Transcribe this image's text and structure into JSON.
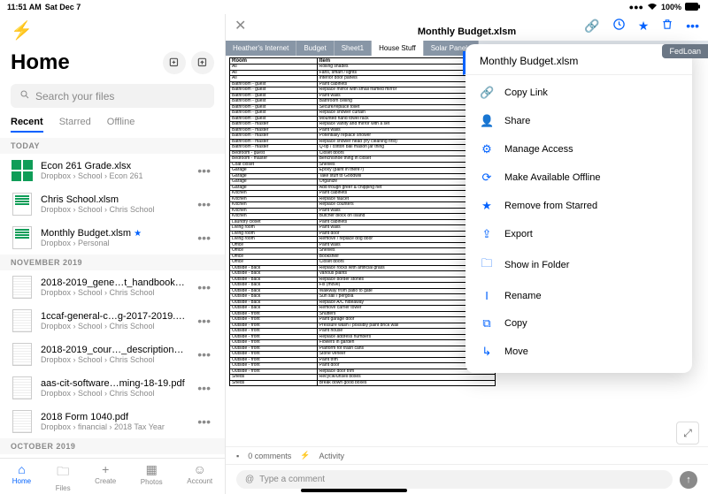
{
  "status": {
    "time": "11:51 AM",
    "date": "Sat Dec 7",
    "signal": "•••",
    "wifi": "⌃",
    "battery_pct": "100%"
  },
  "sidebar": {
    "title": "Home",
    "search_placeholder": "Search your files",
    "tabs": [
      "Recent",
      "Starred",
      "Offline"
    ],
    "sections": [
      {
        "label": "TODAY",
        "files": [
          {
            "name": "Econ 261 Grade.xlsx",
            "path": "Dropbox › School › Econ 261",
            "starred": false,
            "thumb": "sheets"
          },
          {
            "name": "Chris School.xlsm",
            "path": "Dropbox › School › Chris School",
            "starred": false,
            "thumb": "excel"
          },
          {
            "name": "Monthly Budget.xlsm",
            "path": "Dropbox › Personal",
            "starred": true,
            "thumb": "excel"
          }
        ]
      },
      {
        "label": "NOVEMBER 2019",
        "files": [
          {
            "name": "2018-2019_gene…t_handbook.pdf",
            "path": "Dropbox › School › Chris School",
            "starred": false,
            "thumb": "pdf"
          },
          {
            "name": "1ccaf-general-c…g-2017-2019.pdf",
            "path": "Dropbox › School › Chris School",
            "starred": false,
            "thumb": "pdf"
          },
          {
            "name": "2018-2019_cour…_descriptions.pdf",
            "path": "Dropbox › School › Chris School",
            "starred": false,
            "thumb": "pdf"
          },
          {
            "name": "aas-cit-software…ming-18-19.pdf",
            "path": "Dropbox › School › Chris School",
            "starred": false,
            "thumb": "pdf"
          },
          {
            "name": "2018 Form 1040.pdf",
            "path": "Dropbox › financial › 2018 Tax Year",
            "starred": false,
            "thumb": "pdf"
          }
        ]
      },
      {
        "label": "OCTOBER 2019",
        "files": []
      }
    ]
  },
  "bottom_nav": [
    {
      "label": "Home",
      "icon": "⌂"
    },
    {
      "label": "Files",
      "icon": "🗀"
    },
    {
      "label": "Create",
      "icon": "+"
    },
    {
      "label": "Photos",
      "icon": "▦"
    },
    {
      "label": "Account",
      "icon": "☺"
    }
  ],
  "preview": {
    "title": "Monthly Budget.xlsm",
    "sheet_tabs": [
      "Heather's Internet",
      "Budget",
      "Sheet1",
      "House Stuff",
      "Solar Panels"
    ],
    "active_tab": "House Stuff",
    "table_headers": [
      "Room",
      "Item"
    ],
    "table_rows": [
      [
        "All",
        "Rolling shades"
      ],
      [
        "All",
        "Fans, smart / lights"
      ],
      [
        "All",
        "Interior door panels"
      ],
      [
        "Bathroom - guest",
        "Paint cabinets"
      ],
      [
        "Bathroom - guest",
        "Replace mirror with small framed mirror"
      ],
      [
        "Bathroom - guest",
        "Paint walls"
      ],
      [
        "Bathroom - guest",
        "Bathroom ceiling"
      ],
      [
        "Bathroom - guest",
        "Secure/replace toilet"
      ],
      [
        "Bathroom - guest",
        "Replace shower curtain"
      ],
      [
        "Bathroom - guest",
        "Mounted hand towel rack"
      ],
      [
        "Bathroom - master",
        "Replace vanity and mirror with a set"
      ],
      [
        "Bathroom - master",
        "Paint walls"
      ],
      [
        "Bathroom - master",
        "Potentially replace shower"
      ],
      [
        "Bathroom - master",
        "Replace shower head (try cleaning first)"
      ],
      [
        "Bathroom - master",
        "Q-tip / cotton ball mason jar thing"
      ],
      [
        "Bedroom - guest",
        "Closet doors"
      ],
      [
        "Bedroom - master",
        "Bench/shoe thing in closet"
      ],
      [
        "Coat closet",
        "Shelves"
      ],
      [
        "Garage",
        "Epoxy (paint in there?)"
      ],
      [
        "Garage",
        "Take stuff to Goodwill"
      ],
      [
        "Garage",
        "Organize"
      ],
      [
        "Garage",
        "Add trough greer & chipping net"
      ],
      [
        "Kitchen",
        "Paint cabinets"
      ],
      [
        "Kitchen",
        "Replace faucet"
      ],
      [
        "Kitchen",
        "Replace counters"
      ],
      [
        "Kitchen",
        "Paint walls"
      ],
      [
        "Kitchen",
        "Butcher block on island"
      ],
      [
        "Laundry closet",
        "Paint cabinets"
      ],
      [
        "Living room",
        "Paint walls"
      ],
      [
        "Living room",
        "Paint door"
      ],
      [
        "Living room",
        "Remove / replace dog door"
      ],
      [
        "Office",
        "Paint walls"
      ],
      [
        "Office",
        "Shelves"
      ],
      [
        "Office",
        "Bookshelf"
      ],
      [
        "Office",
        "Closet doors"
      ],
      [
        "Outside - back",
        "Replace rocks with artificial grass"
      ],
      [
        "Outside - back",
        "Various plants"
      ],
      [
        "Outside - back",
        "Replace border stones"
      ],
      [
        "Outside - back",
        "Fix (move)"
      ],
      [
        "Outside - back",
        "Walkway from patio to gate"
      ],
      [
        "Outside - back",
        "Sun sail / pergola"
      ],
      [
        "Outside - back",
        "Replace A/C hideaway"
      ],
      [
        "Outside - back",
        "Remove carrier tower"
      ],
      [
        "Outside - front",
        "Shutters"
      ],
      [
        "Outside - front",
        "Paint garage door"
      ],
      [
        "Outside - front",
        "Pressure wash / possibly paint brick wall"
      ],
      [
        "Outside - front",
        "Paint house"
      ],
      [
        "Outside - front",
        "Replace address numbers"
      ],
      [
        "Outside - front",
        "Flowers in garden"
      ],
      [
        "Outside - front",
        "Platform for trash cans"
      ],
      [
        "Outside - front",
        "Stone veneer"
      ],
      [
        "Outside - front",
        "Paint trim"
      ],
      [
        "Outside - front",
        "Paint door"
      ],
      [
        "Outside - front",
        "Replace door trim"
      ],
      [
        "Sheds",
        "Recycle/unsell boxes"
      ],
      [
        "Sheds",
        "Break down good boxes"
      ]
    ],
    "comments_count": "0 comments",
    "activity_label": "Activity",
    "comment_placeholder": "Type a comment"
  },
  "popover": {
    "title": "Monthly Budget.xlsm",
    "items": [
      {
        "label": "Copy Link",
        "icon": "🔗"
      },
      {
        "label": "Share",
        "icon": "👤"
      },
      {
        "label": "Manage Access",
        "icon": "⚙"
      },
      {
        "label": "Make Available Offline",
        "icon": "⟳"
      },
      {
        "label": "Remove from Starred",
        "icon": "★"
      },
      {
        "label": "Export",
        "icon": "⇪"
      },
      {
        "label": "Show in Folder",
        "icon": "🗀"
      },
      {
        "label": "Rename",
        "icon": "I"
      },
      {
        "label": "Copy",
        "icon": "⧉"
      },
      {
        "label": "Move",
        "icon": "↳"
      }
    ]
  },
  "fedloan_tag": "FedLoan"
}
